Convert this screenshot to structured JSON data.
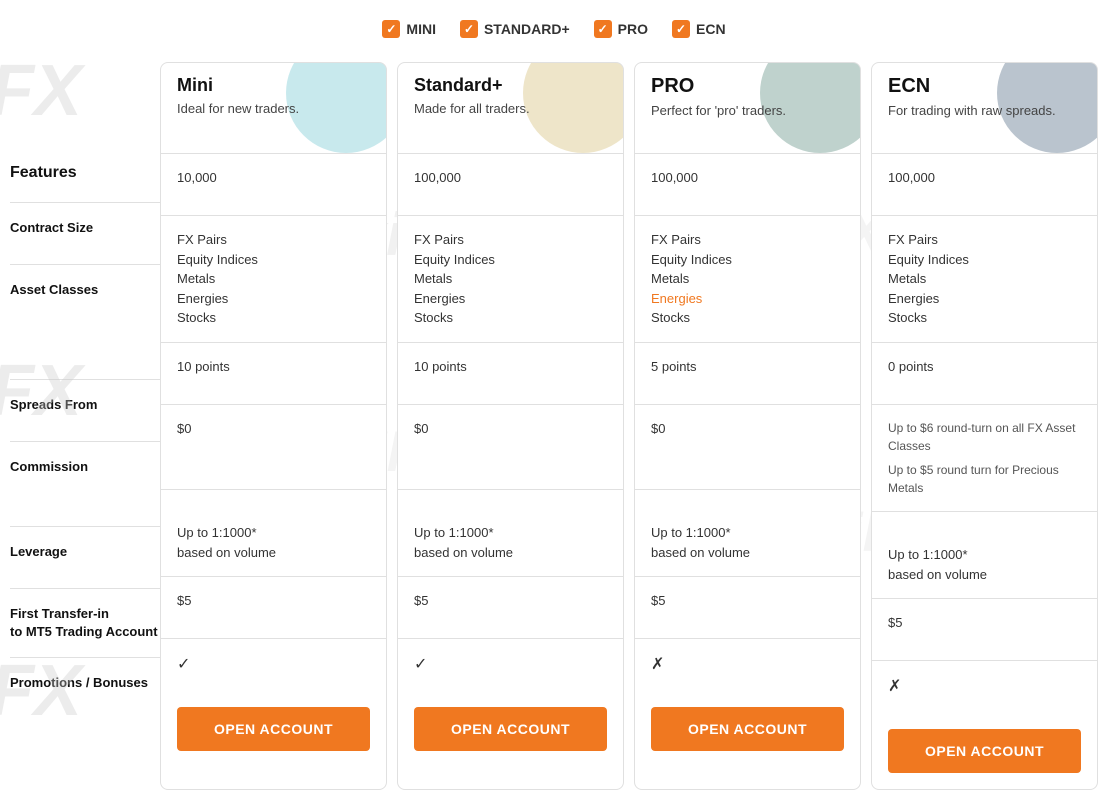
{
  "filters": [
    {
      "label": "MINI",
      "checked": true
    },
    {
      "label": "STANDARD+",
      "checked": true
    },
    {
      "label": "PRO",
      "checked": true
    },
    {
      "label": "ECN",
      "checked": true
    }
  ],
  "features_header": "Features",
  "features": [
    {
      "label": "Contract Size"
    },
    {
      "label": "Asset Classes"
    },
    {
      "label": "Spreads From"
    },
    {
      "label": "Commission"
    },
    {
      "label": "Leverage"
    },
    {
      "label": "First Transfer-in\nto MT5 Trading Account"
    },
    {
      "label": "Promotions / Bonuses"
    }
  ],
  "accounts": [
    {
      "name": "Mini",
      "tagline": "Ideal for new traders.",
      "deco_color": "#4ab5c4",
      "contract_size": "10,000",
      "asset_classes": [
        "FX Pairs",
        "Equity Indices",
        "Metals",
        "Energies",
        "Stocks"
      ],
      "energies_colored": false,
      "spreads_from": "10 points",
      "commission": "$0",
      "leverage": "Up to 1:1000*\nbased on volume",
      "first_transfer": "$5",
      "promotions": "✓",
      "open_btn": "OPEN ACCOUNT"
    },
    {
      "name": "Standard+",
      "tagline": "Made for all traders.",
      "deco_color": "#c8a84b",
      "contract_size": "100,000",
      "asset_classes": [
        "FX Pairs",
        "Equity Indices",
        "Metals",
        "Energies",
        "Stocks"
      ],
      "energies_colored": false,
      "spreads_from": "10 points",
      "commission": "$0",
      "leverage": "Up to 1:1000*\nbased on volume",
      "first_transfer": "$5",
      "promotions": "✓",
      "open_btn": "OPEN ACCOUNT"
    },
    {
      "name": "PRO",
      "tagline": "Perfect for 'pro' traders.",
      "deco_color": "#2a6b5a",
      "contract_size": "100,000",
      "asset_classes": [
        "FX Pairs",
        "Equity Indices",
        "Metals",
        "Energies",
        "Stocks"
      ],
      "energies_colored": true,
      "spreads_from": "5 points",
      "commission": "$0",
      "leverage": "Up to 1:1000*\nbased on volume",
      "first_transfer": "$5",
      "promotions": "✗",
      "open_btn": "OPEN ACCOUNT"
    },
    {
      "name": "ECN",
      "tagline": "For trading with raw spreads.",
      "deco_color": "#1a3a5c",
      "contract_size": "100,000",
      "asset_classes": [
        "FX Pairs",
        "Equity Indices",
        "Metals",
        "Energies",
        "Stocks"
      ],
      "energies_colored": false,
      "spreads_from": "0 points",
      "commission_lines": [
        "Up to $6 round-turn on all FX Asset Classes",
        "Up to $5 round turn for Precious Metals"
      ],
      "leverage": "Up to 1:1000*\nbased on volume",
      "first_transfer": "$5",
      "promotions": "✗",
      "open_btn": "OPEN ACCOUNT"
    }
  ],
  "watermarks": [
    "FX",
    "FX",
    "FX",
    "WikiFX",
    "WikiFX",
    "W"
  ]
}
